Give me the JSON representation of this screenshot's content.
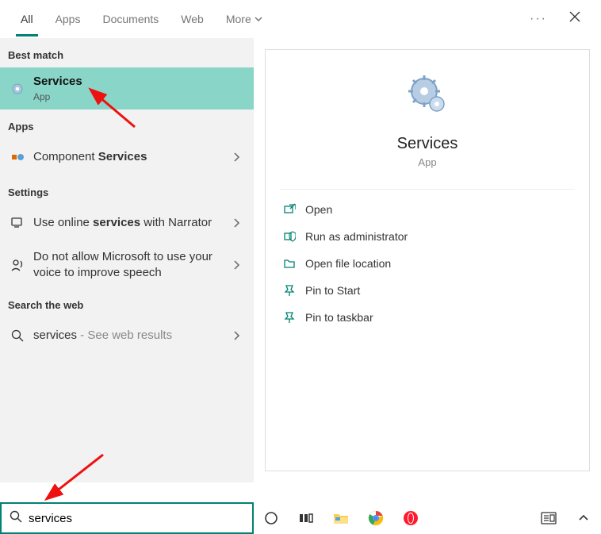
{
  "tabs": {
    "all": "All",
    "apps": "Apps",
    "documents": "Documents",
    "web": "Web",
    "more": "More"
  },
  "sections": {
    "best": "Best match",
    "apps": "Apps",
    "settings": "Settings",
    "webSearch": "Search the web"
  },
  "bestMatch": {
    "title": "Services",
    "sub": "App"
  },
  "appsResults": {
    "componentServices": {
      "pre": "Component ",
      "bold": "Services"
    }
  },
  "settingsResults": {
    "narrator": {
      "pre": "Use online ",
      "bold": "services",
      "post": " with Narrator"
    },
    "voice": "Do not allow Microsoft to use your voice to improve speech"
  },
  "webResults": {
    "services": {
      "bold": "services",
      "suffix": " - See web results"
    }
  },
  "detail": {
    "title": "Services",
    "sub": "App"
  },
  "actions": {
    "open": "Open",
    "runAdmin": "Run as administrator",
    "openLocation": "Open file location",
    "pinStart": "Pin to Start",
    "pinTaskbar": "Pin to taskbar"
  },
  "search": {
    "value": "services"
  }
}
